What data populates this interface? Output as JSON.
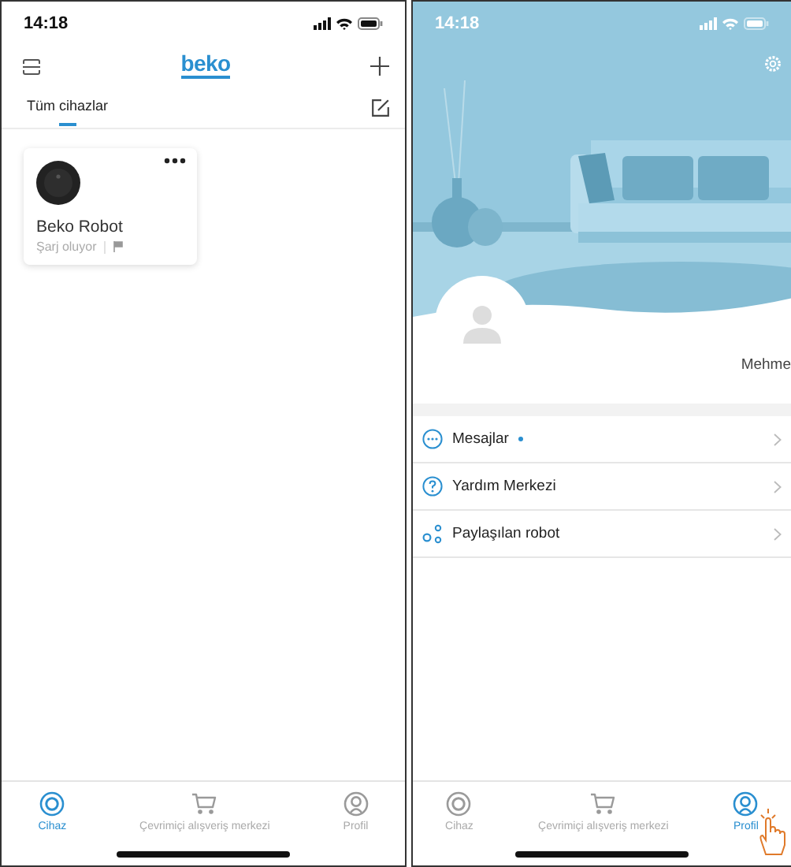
{
  "screens": [
    {
      "kind": "devices",
      "status_bar": {
        "time": "14:18"
      },
      "header": {
        "logo": "beko"
      },
      "tabs": [
        {
          "label": "Tüm cihazlar",
          "selected": true
        }
      ],
      "devices": [
        {
          "name": "Beko Robot",
          "status": "Şarj oluyor"
        }
      ],
      "tab_bar": [
        {
          "label": "Cihaz",
          "selected": true
        },
        {
          "label": "Çevrimiçi alışveriş merkezi",
          "selected": false
        },
        {
          "label": "Profil",
          "selected": false
        }
      ]
    },
    {
      "kind": "profile",
      "status_bar": {
        "time": "14:18"
      },
      "user_name": "Mehme",
      "menu": [
        {
          "label": "Mesajlar",
          "unread": true
        },
        {
          "label": "Yardım Merkezi",
          "unread": false
        },
        {
          "label": "Paylaşılan robot",
          "unread": false
        }
      ],
      "tab_bar": [
        {
          "label": "Cihaz",
          "selected": false
        },
        {
          "label": "Çevrimiçi alışveriş merkezi",
          "selected": false
        },
        {
          "label": "Profil",
          "selected": true
        }
      ]
    }
  ]
}
